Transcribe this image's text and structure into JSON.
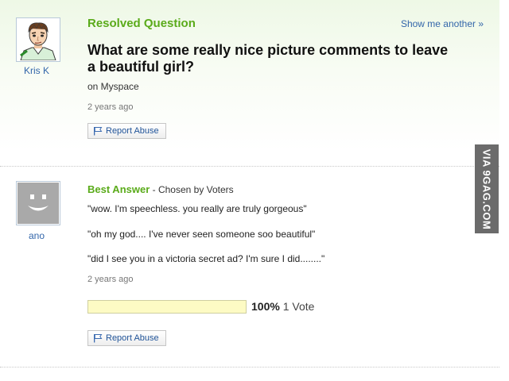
{
  "question": {
    "section_title": "Resolved Question",
    "show_another": "Show me another »",
    "title_line1": "What are some really nice picture comments to leave",
    "title_line2": "a beautiful girl?",
    "detail": "on Myspace",
    "timestamp": "2 years ago",
    "report_label": "Report Abuse",
    "user": {
      "name": "Kris K",
      "avatar": "cartoon-boy-avatar"
    }
  },
  "answer": {
    "section_title": "Best Answer",
    "chosen_by": " - Chosen by Voters",
    "lines": [
      "\"wow. I'm speechless. you really are truly gorgeous\"",
      "\"oh my god.... I've never seen someone soo beautiful\"",
      "\"did I see you in a victoria secret ad? I'm sure I did........\""
    ],
    "timestamp": "2 years ago",
    "vote_fraction": 1.0,
    "vote_percent": "100%",
    "vote_count": "1 Vote",
    "report_label": "Report Abuse",
    "user": {
      "name": "ano",
      "avatar": "default-smiley-avatar"
    }
  },
  "watermark": {
    "text": "VIA 9GAG.COM"
  },
  "colors": {
    "accent_green": "#5aab1a",
    "link_blue": "#3366aa",
    "vote_bar_fill": "#fdfbc4",
    "watermark_bg": "#6b6b6b"
  }
}
